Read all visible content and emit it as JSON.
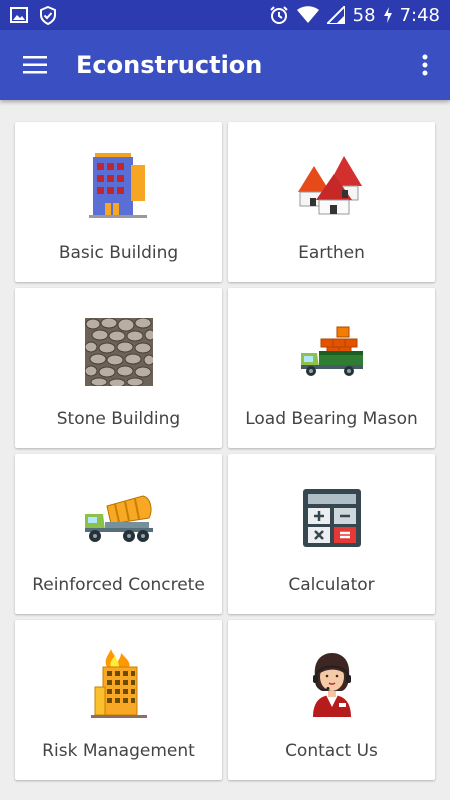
{
  "status_bar": {
    "battery": "58",
    "time": "7:48"
  },
  "app_bar": {
    "title": "Econstruction",
    "menu_icon": "hamburger-menu-icon",
    "overflow_icon": "more-vert-icon"
  },
  "colors": {
    "status_bar": "#2c3bb0",
    "app_bar": "#3a4fc1",
    "background": "#eeeeee",
    "card": "#ffffff"
  },
  "tiles": [
    {
      "label": "Basic Building",
      "icon": "building-icon"
    },
    {
      "label": "Earthen",
      "icon": "earthen-huts-icon"
    },
    {
      "label": "Stone Building",
      "icon": "stone-wall-icon"
    },
    {
      "label": "Load Bearing Mason",
      "icon": "truck-bricks-icon"
    },
    {
      "label": "Reinforced Concrete",
      "icon": "concrete-mixer-icon"
    },
    {
      "label": "Calculator",
      "icon": "calculator-icon"
    },
    {
      "label": "Risk Management",
      "icon": "burning-building-icon"
    },
    {
      "label": "Contact Us",
      "icon": "support-agent-icon"
    }
  ]
}
